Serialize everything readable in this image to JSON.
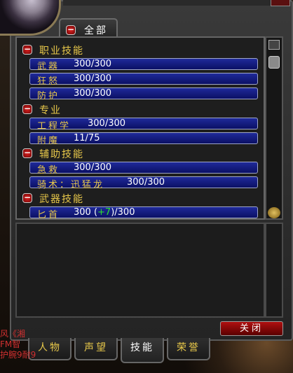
{
  "window": {
    "title": "·········"
  },
  "filter": {
    "label": "全部"
  },
  "skills": {
    "sections": [
      {
        "title": "职业技能",
        "items": [
          {
            "name": "武器",
            "value": "300/300"
          },
          {
            "name": "狂怒",
            "value": "300/300"
          },
          {
            "name": "防护",
            "value": "300/300"
          }
        ]
      },
      {
        "title": "专业",
        "items": [
          {
            "name": "工程学",
            "value": "300/300"
          },
          {
            "name": "附魔",
            "value": "11/75"
          }
        ]
      },
      {
        "title": "辅助技能",
        "items": [
          {
            "name": "急救",
            "value": "300/300"
          },
          {
            "name": "骑术：迅猛龙",
            "value": "300/300"
          }
        ]
      },
      {
        "title": "武器技能",
        "items": [
          {
            "name": "匕首",
            "value_base": "300 (",
            "value_bonus": "+7",
            "value_max": ")/300"
          }
        ]
      }
    ]
  },
  "buttons": {
    "close": "关闭"
  },
  "tabs": [
    {
      "label": "人物"
    },
    {
      "label": "声望"
    },
    {
      "label": "技能"
    },
    {
      "label": "荣誉"
    }
  ],
  "chat": {
    "line1": "风《湘",
    "line2": "FM智",
    "line3": "护腕9耐9"
  },
  "colors": {
    "gold_text": "#e8c84a",
    "bar_blue": "#1f2a9a",
    "close_red": "#b01010",
    "bonus_green": "#2ee02e"
  }
}
